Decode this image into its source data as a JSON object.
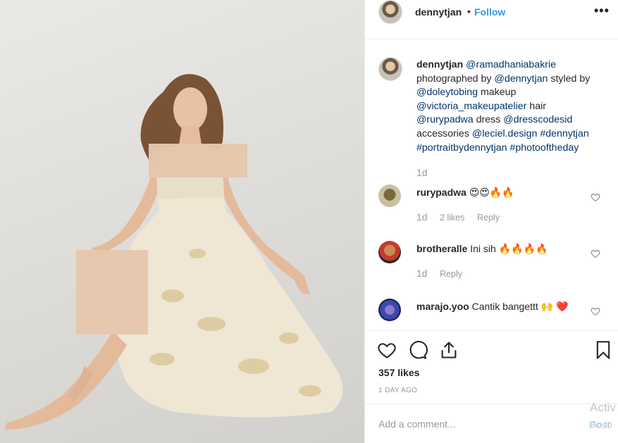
{
  "post": {
    "username": "dennytjan",
    "separator": "•",
    "follow_label": "Follow",
    "more_label": "•••",
    "caption": "@ramadhaniabakrie photographed by @dennytjan styled by @doleytobing makeup @victoria_makeupatelier hair @rurypadwa dress @dresscodesid accessories @leciel.design #dennytjan #portraitbydennytjan #photooftheday",
    "caption_time": "1d",
    "comments": [
      {
        "username": "rurypadwa",
        "text": "😍😍🔥🔥",
        "time": "1d",
        "likes": "2 likes",
        "reply": "Reply"
      },
      {
        "username": "brotheralle",
        "text": "Ini sih 🔥🔥🔥🔥",
        "time": "1d",
        "reply": "Reply"
      },
      {
        "username": "marajo.yoo",
        "text": "Cantik bangettt 🙌 ❤️"
      }
    ],
    "likes": "357 likes",
    "posted_ago": "1 DAY AGO",
    "comment_placeholder": "Add a comment...",
    "post_label": "Post"
  },
  "watermark": {
    "line1": "Activ",
    "line2": "Go to"
  },
  "colors": {
    "link": "#3897f0",
    "muted": "#999999",
    "text": "#262626",
    "heart": "#ed4956"
  }
}
